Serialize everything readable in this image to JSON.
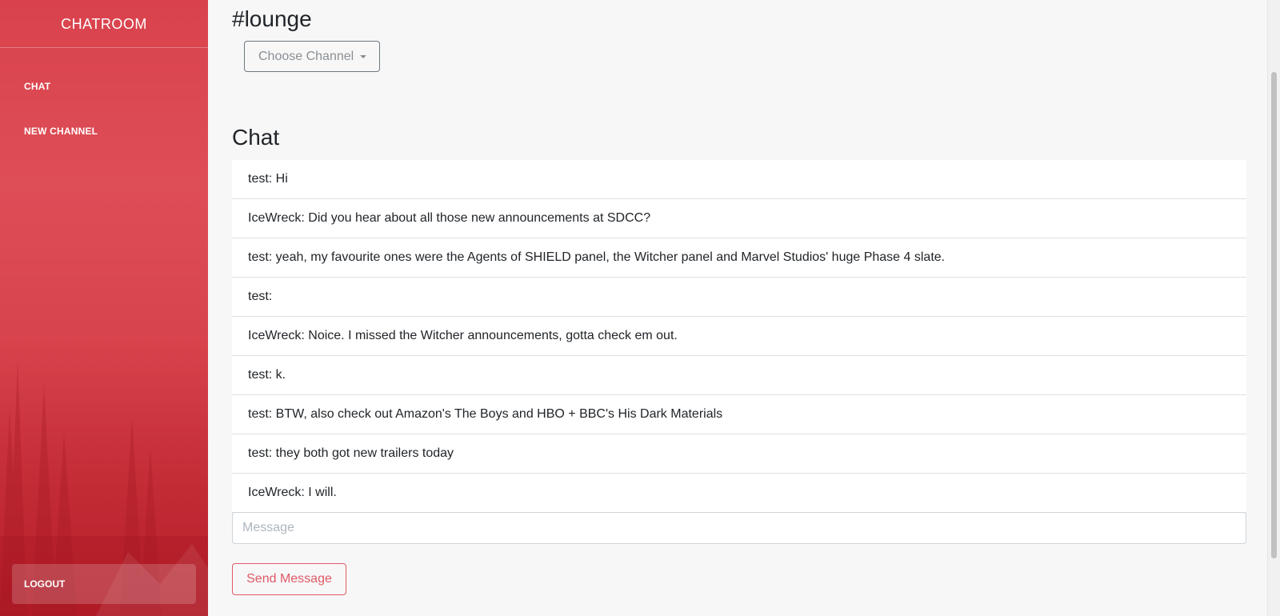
{
  "sidebar": {
    "brand": "CHATROOM",
    "items": [
      {
        "label": "CHAT"
      },
      {
        "label": "NEW CHANNEL"
      }
    ],
    "logout_label": "LOGOUT"
  },
  "main": {
    "channel_title": "#lounge",
    "channel_dropdown_label": "Choose Channel",
    "chat_title": "Chat",
    "messages": [
      "test: Hi",
      "IceWreck: Did you hear about all those new announcements at SDCC?",
      "test: yeah, my favourite ones were the Agents of SHIELD panel, the Witcher panel and Marvel Studios' huge Phase 4 slate.",
      "test:",
      "IceWreck: Noice. I missed the Witcher announcements, gotta check em out.",
      "test: k.",
      "test: BTW, also check out Amazon's The Boys and HBO + BBC's His Dark Materials",
      "test: they both got new trailers today",
      "IceWreck: I will."
    ],
    "message_input": {
      "value": "",
      "placeholder": "Message"
    },
    "send_label": "Send Message"
  },
  "colors": {
    "sidebar_accent": "#d9424c",
    "button_accent": "#e05a66",
    "background": "#f7f7f7"
  }
}
